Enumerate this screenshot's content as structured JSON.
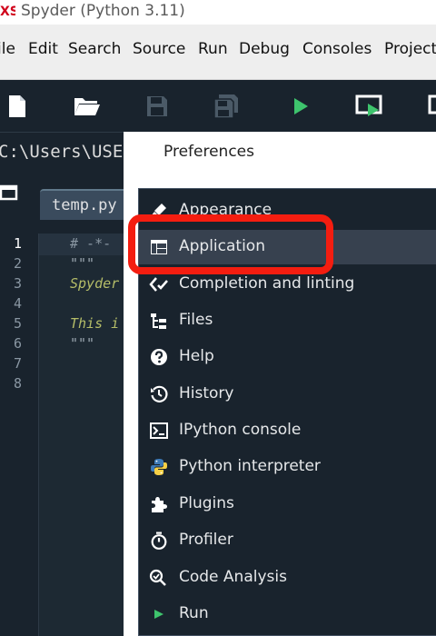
{
  "window": {
    "title": "Spyder (Python 3.11)",
    "app_icon_text": "XS"
  },
  "menubar": {
    "items": [
      "ile",
      "Edit",
      "Search",
      "Source",
      "Run",
      "Debug",
      "Consoles",
      "Project"
    ]
  },
  "toolbar": {
    "buttons": [
      "new-file-icon",
      "open-folder-icon",
      "save-icon",
      "save-all-icon",
      "run-icon",
      "run-cell-icon",
      "run-cell-advance-icon"
    ]
  },
  "pathbar": {
    "path": "C:\\Users\\USE"
  },
  "editor": {
    "tab_label": "temp.py",
    "line_numbers": [
      "1",
      "2",
      "3",
      "4",
      "5",
      "6",
      "7",
      "8"
    ],
    "code": {
      "line1": "# -*-",
      "line2": "\"\"\"",
      "line3": "Spyder",
      "line5": "This i",
      "line6": "\"\"\""
    }
  },
  "preferences": {
    "title": "Preferences",
    "items": [
      {
        "label": "Appearance",
        "icon": "paintbrush-icon"
      },
      {
        "label": "Application",
        "icon": "window-layout-icon",
        "selected": true
      },
      {
        "label": "Completion and linting",
        "icon": "completion-icon"
      },
      {
        "label": "Files",
        "icon": "file-tree-icon"
      },
      {
        "label": "Help",
        "icon": "help-icon"
      },
      {
        "label": "History",
        "icon": "history-icon"
      },
      {
        "label": "IPython console",
        "icon": "console-icon"
      },
      {
        "label": "Python interpreter",
        "icon": "python-icon"
      },
      {
        "label": "Plugins",
        "icon": "puzzle-icon"
      },
      {
        "label": "Profiler",
        "icon": "stopwatch-icon"
      },
      {
        "label": "Code Analysis",
        "icon": "code-analysis-icon"
      },
      {
        "label": "Run",
        "icon": "run-triangle-icon"
      }
    ]
  },
  "colors": {
    "highlight": "#f41d10",
    "run_green": "#3ec46d",
    "background": "#19232d"
  }
}
